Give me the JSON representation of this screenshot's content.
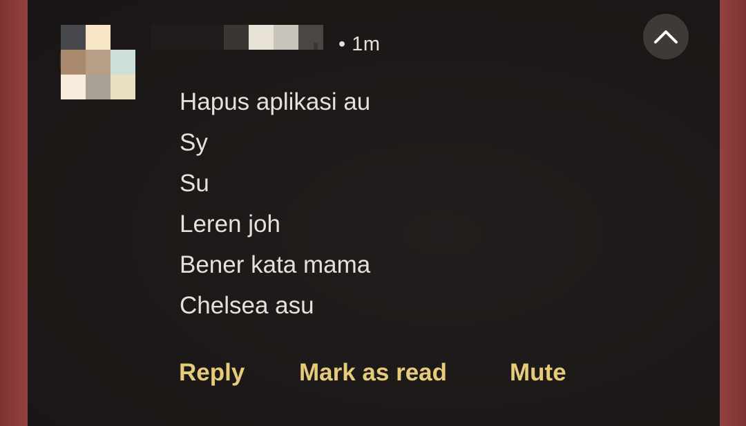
{
  "notification": {
    "time": "• 1m",
    "messages": [
      "Hapus aplikasi au",
      "Sy",
      "Su",
      "Leren joh",
      "Bener kata mama",
      "Chelsea asu"
    ],
    "actions": {
      "reply": "Reply",
      "mark_as_read": "Mark as read",
      "mute": "Mute"
    },
    "collapse_icon": "chevron-up-icon"
  },
  "colors": {
    "card_background": "#1c1817",
    "message_text": "#e6e1dc",
    "action_text": "#e6cc7a",
    "collapse_button": "#3d3a37",
    "side_background": "#8b3a3a"
  },
  "avatar": {
    "pixelated": true,
    "pixels": [
      "#46484c",
      "#f6e6c6",
      "#1c1817",
      "#aa8a6e",
      "#b89e86",
      "#cde0d8",
      "#f8ebdb",
      "#a9a096",
      "#eadfc3"
    ]
  },
  "sender": {
    "pixelated": true,
    "pixels": [
      "#3a3634",
      "#e8e2d6",
      "#c9c4bb",
      "#4a4644"
    ]
  }
}
